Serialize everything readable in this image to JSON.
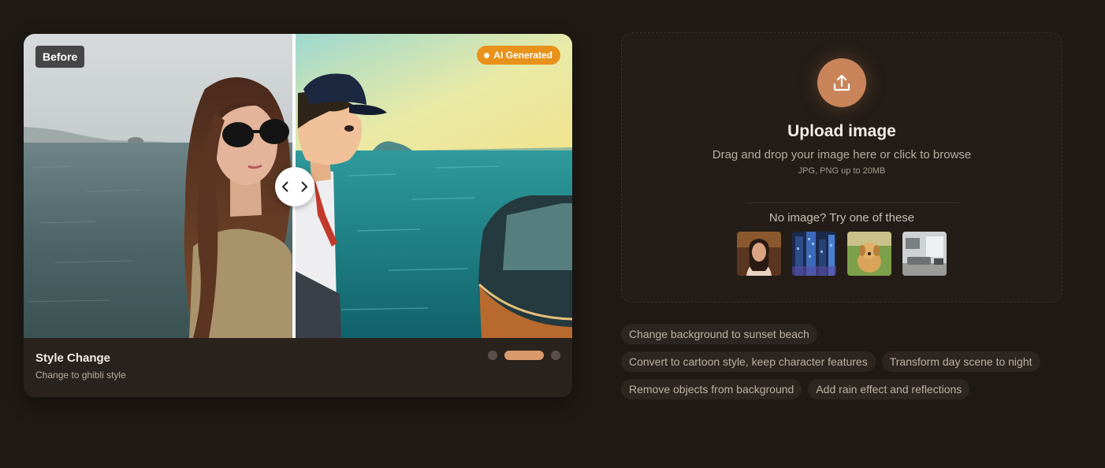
{
  "comparison": {
    "before_label": "Before",
    "after_badge": "AI Generated",
    "slider_icon": "chevron-left-right-icon",
    "caption_title": "Style Change",
    "caption_subtitle": "Change to ghibli style",
    "active_slide": 2,
    "slide_count": 3
  },
  "upload": {
    "icon": "upload-icon",
    "title": "Upload image",
    "description": "Drag and drop your image here or click to browse",
    "hint": "JPG, PNG up to 20MB",
    "samples_label": "No image? Try one of these",
    "samples": [
      "portrait",
      "neon-city",
      "puppy",
      "living-room"
    ]
  },
  "prompts": [
    [
      "Change background to sunset beach"
    ],
    [
      "Convert to cartoon style, keep character features",
      "Transform day scene to night"
    ],
    [
      "Remove objects from background",
      "Add rain effect and reflections"
    ]
  ],
  "colors": {
    "background": "#1f1914",
    "accent": "#c9845a",
    "badge": "#e8921c"
  }
}
